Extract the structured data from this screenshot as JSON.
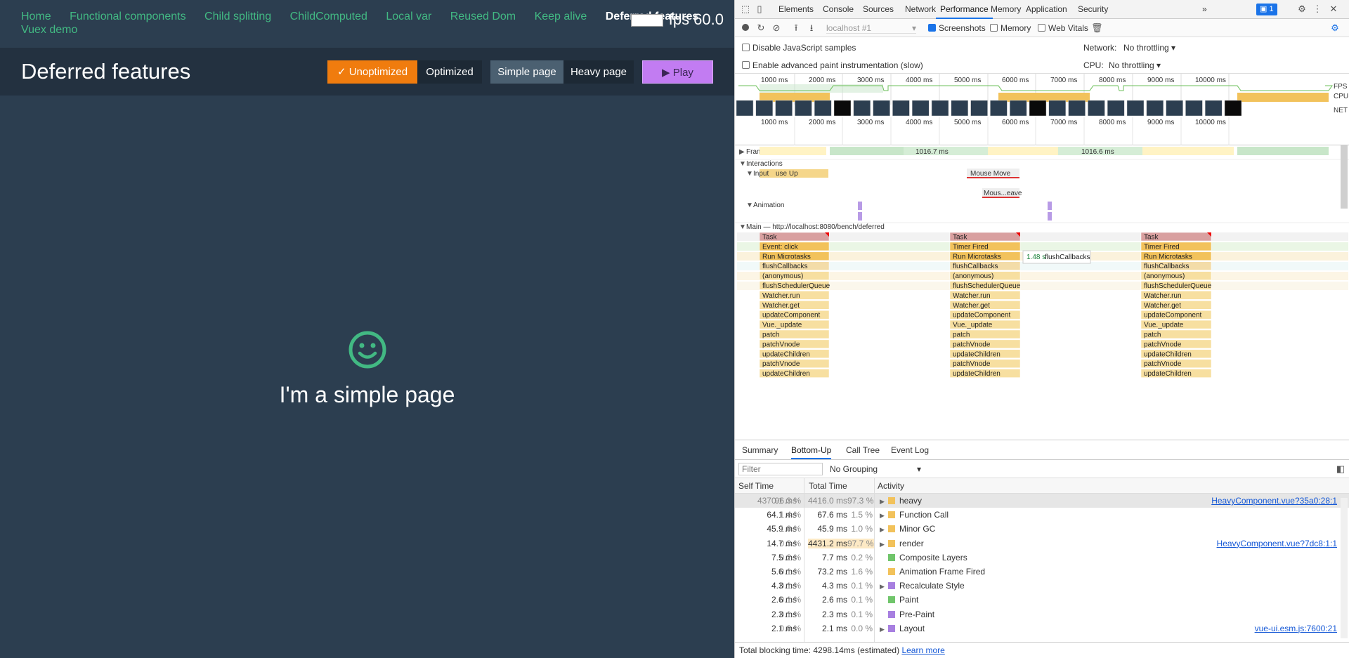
{
  "app": {
    "nav": [
      "Home",
      "Functional components",
      "Child splitting",
      "ChildComputed",
      "Local var",
      "Reused Dom",
      "Keep alive",
      "Deferred features",
      "Vuex demo"
    ],
    "active_nav": "Deferred features",
    "fps": "fps 60.0",
    "page_title": "Deferred features",
    "buttons": {
      "unoptimized": "Unoptimized",
      "optimized": "Optimized",
      "simple": "Simple page",
      "heavy": "Heavy page",
      "play": "Play"
    },
    "content_text": "I'm a simple page",
    "smiley_icon": "smiley-face-icon",
    "colors": {
      "bg": "#2c3e50",
      "accent": "#42b983",
      "unopt": "#f07c0e",
      "play": "#c27cf2"
    }
  },
  "devtools": {
    "tabs": [
      "Elements",
      "Console",
      "Sources",
      "Network",
      "Performance",
      "Memory",
      "Application",
      "Security"
    ],
    "active_tab": "Performance",
    "more_tabs": "»",
    "issues_badge": "1",
    "target": "localhost #1",
    "screenshots_label": "Screenshots",
    "memory_label": "Memory",
    "web_vitals_label": "Web Vitals",
    "disable_js_samples": "Disable JavaScript samples",
    "enable_paint": "Enable advanced paint instrumentation (slow)",
    "network_label": "Network:",
    "network_value": "No throttling",
    "cpu_label": "CPU:",
    "cpu_value": "No throttling",
    "overview_ticks": [
      "1000 ms",
      "2000 ms",
      "3000 ms",
      "4000 ms",
      "5000 ms",
      "6000 ms",
      "7000 ms",
      "8000 ms",
      "9000 ms",
      "10000 ms"
    ],
    "lane_labels": [
      "FPS",
      "CPU",
      "NET"
    ],
    "flame": {
      "frames_label": "Frames",
      "frame_times": [
        "1016.7 ms",
        "1016.6 ms"
      ],
      "interactions_label": "Interactions",
      "input_label": "Input",
      "input_event": "use Up",
      "mouse_move": "Mouse Move",
      "mouse_leave": "Mous...eave",
      "animation_label": "Animation",
      "main_label": "Main — http://localhost:8080/bench/deferred",
      "tooltip_time": "1.48 s",
      "tooltip_name": "flushCallbacks",
      "stack1": [
        "Task",
        "Event: click",
        "Run Microtasks",
        "flushCallbacks",
        "(anonymous)",
        "flushSchedulerQueue",
        "Watcher.run",
        "Watcher.get",
        "updateComponent",
        "Vue._update",
        "patch",
        "patchVnode",
        "updateChildren",
        "patchVnode",
        "updateChildren"
      ],
      "stack2": [
        "Task",
        "Timer Fired",
        "Run Microtasks",
        "flushCallbacks",
        "(anonymous)",
        "flushSchedulerQueue",
        "Watcher.run",
        "Watcher.get",
        "updateComponent",
        "Vue._update",
        "patch",
        "patchVnode",
        "updateChildren",
        "patchVnode",
        "updateChildren"
      ],
      "stack3": [
        "Task",
        "Timer Fired",
        "Run Microtasks",
        "flushCallbacks",
        "(anonymous)",
        "flushSchedulerQueue",
        "Watcher.run",
        "Watcher.get",
        "updateComponent",
        "Vue._update",
        "patch",
        "patchVnode",
        "updateChildren",
        "patchVnode",
        "updateChildren"
      ]
    },
    "bottom_tabs": [
      "Summary",
      "Bottom-Up",
      "Call Tree",
      "Event Log"
    ],
    "active_bottom_tab": "Bottom-Up",
    "filter_placeholder": "Filter",
    "grouping": "No Grouping",
    "columns": [
      "Self Time",
      "Total Time",
      "Activity"
    ],
    "rows": [
      {
        "self": "4370.1 ms",
        "self_pct": "96.3 %",
        "total": "4416.0 ms",
        "total_pct": "97.3 %",
        "activity": "heavy",
        "color": "#f2c25b",
        "expand": true,
        "link": "HeavyComponent.vue?35a0:28:1"
      },
      {
        "self": "64.1 ms",
        "self_pct": "1.4 %",
        "total": "67.6 ms",
        "total_pct": "1.5 %",
        "activity": "Function Call",
        "color": "#f2c25b",
        "expand": true,
        "link": ""
      },
      {
        "self": "45.9 ms",
        "self_pct": "1.0 %",
        "total": "45.9 ms",
        "total_pct": "1.0 %",
        "activity": "Minor GC",
        "color": "#f2c25b",
        "expand": true,
        "link": ""
      },
      {
        "self": "14.7 ms",
        "self_pct": "0.3 %",
        "total": "4431.2 ms",
        "total_pct": "97.7 %",
        "activity": "render",
        "color": "#f2c25b",
        "expand": true,
        "link": "HeavyComponent.vue?7dc8:1:1"
      },
      {
        "self": "7.5 ms",
        "self_pct": "0.2 %",
        "total": "7.7 ms",
        "total_pct": "0.2 %",
        "activity": "Composite Layers",
        "color": "#70c56b",
        "expand": false,
        "link": ""
      },
      {
        "self": "5.6 ms",
        "self_pct": "0.1 %",
        "total": "73.2 ms",
        "total_pct": "1.6 %",
        "activity": "Animation Frame Fired",
        "color": "#f2c25b",
        "expand": false,
        "link": ""
      },
      {
        "self": "4.3 ms",
        "self_pct": "0.1 %",
        "total": "4.3 ms",
        "total_pct": "0.1 %",
        "activity": "Recalculate Style",
        "color": "#a77fe0",
        "expand": true,
        "link": ""
      },
      {
        "self": "2.6 ms",
        "self_pct": "0.1 %",
        "total": "2.6 ms",
        "total_pct": "0.1 %",
        "activity": "Paint",
        "color": "#70c56b",
        "expand": false,
        "link": ""
      },
      {
        "self": "2.3 ms",
        "self_pct": "0.1 %",
        "total": "2.3 ms",
        "total_pct": "0.1 %",
        "activity": "Pre-Paint",
        "color": "#a77fe0",
        "expand": false,
        "link": ""
      },
      {
        "self": "2.1 ms",
        "self_pct": "0.0 %",
        "total": "2.1 ms",
        "total_pct": "0.0 %",
        "activity": "Layout",
        "color": "#a77fe0",
        "expand": true,
        "link": "vue-ui.esm.js:7600:21"
      }
    ],
    "status_text": "Total blocking time: 4298.14ms (estimated)",
    "learn_more": "Learn more"
  }
}
